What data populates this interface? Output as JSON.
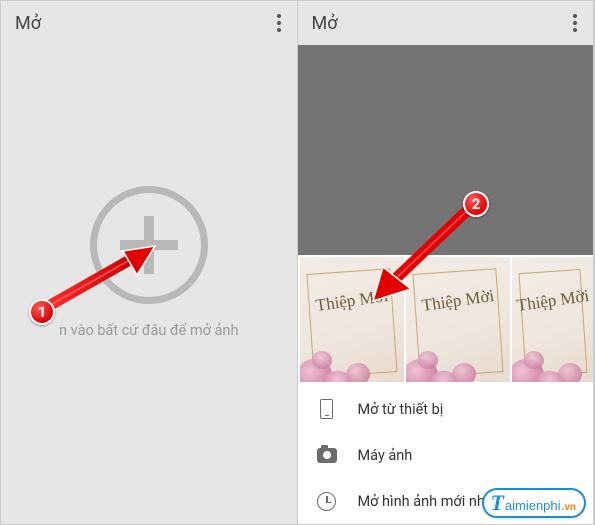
{
  "left": {
    "title": "Mở",
    "tap_hint": "n vào bất cứ đâu để mở ảnh"
  },
  "right": {
    "title": "Mở",
    "thumb_script": "Thiệp Mời",
    "options": {
      "device": "Mở từ thiết bị",
      "camera": "Máy ảnh",
      "recent": "Mở hình ảnh mới nhất"
    }
  },
  "markers": {
    "m1": "1",
    "m2": "2"
  },
  "watermark": {
    "t": "T",
    "text": "aimienphi",
    "vn": ".vn"
  }
}
